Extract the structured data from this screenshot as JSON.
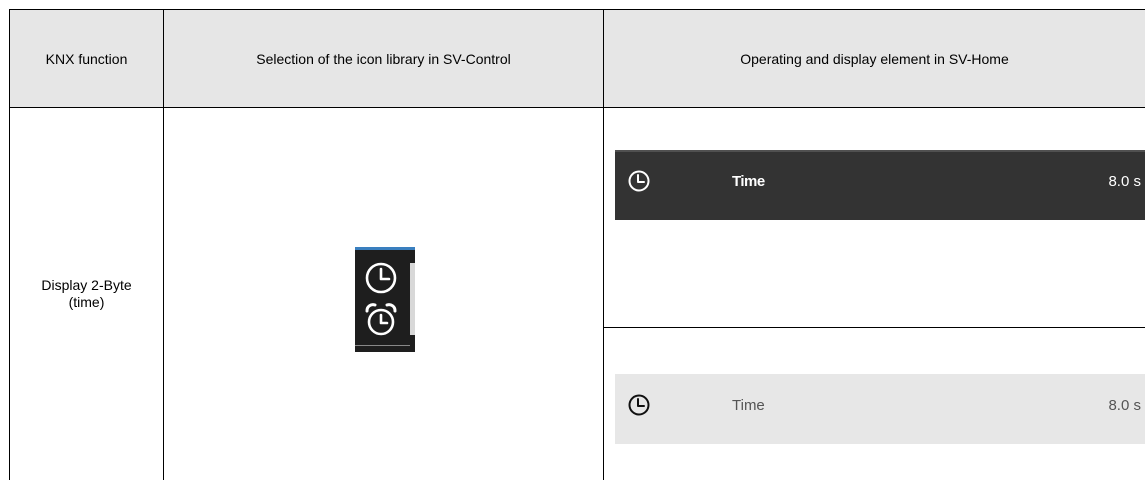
{
  "table": {
    "headers": [
      "KNX function",
      "Selection of the icon library in SV-Control",
      "Operating and display element in SV-Home"
    ],
    "row": {
      "knx_function": "Display 2-Byte\n(time)",
      "icon_library": [
        "clock-icon",
        "alarm-clock-icon"
      ],
      "elements": [
        {
          "variant": "dark",
          "icon": "clock-icon",
          "label": "Time",
          "value": "8.0 s"
        },
        {
          "variant": "light",
          "icon": "clock-icon",
          "label": "Time",
          "value": "8.0 s"
        }
      ]
    }
  },
  "colors": {
    "header_bg": "#e6e6e6",
    "dark_tile_bg": "#333333",
    "light_tile_bg": "#e7e7e7",
    "library_bg": "#1e1e1e",
    "library_accent": "#3a7fbf"
  }
}
